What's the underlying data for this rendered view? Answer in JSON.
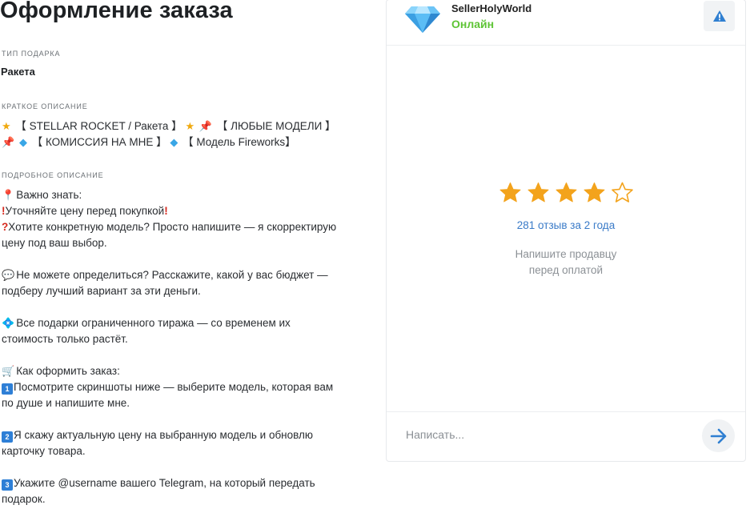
{
  "page": {
    "title": "Оформление заказа"
  },
  "gift_type": {
    "label": "ТИП ПОДАРКА",
    "value": "Ракета"
  },
  "short_description": {
    "label": "КРАТКОЕ ОПИСАНИЕ",
    "line1": "【 STELLAR ROCKET / Ракета 】",
    "line1b": "【 ЛЮБЫЕ МОДЕЛИ 】",
    "line2": "【 КОМИССИЯ НА МНЕ 】",
    "line2b": "【 Модель Fireworks】"
  },
  "long_description": {
    "label": "ПОДРОБНОЕ ОПИСАНИЕ",
    "important": "Важно знать:",
    "check_price": "Уточняйте цену перед покупкой",
    "want_model_1": "Хотите конкретную модель? Просто напишите — я скорректирую",
    "want_model_2": "цену под ваш выбор.",
    "budget_1": "Не можете определиться? Расскажите, какой у вас бюджет —",
    "budget_2": "подберу лучший вариант за эти деньги.",
    "limited_1": "Все подарки ограниченного тиража — со временем их",
    "limited_2": "стоимость только растёт.",
    "how_to": "Как оформить заказ:",
    "step1_num": "1",
    "step1_a": "Посмотрите скриншоты ниже — выберите модель, которая вам",
    "step1_b": "по душе и напишите мне.",
    "step2_num": "2",
    "step2_a": "Я скажу актуальную цену на выбранную модель и обновлю",
    "step2_b": "карточку товара.",
    "step3_num": "3",
    "step3_a": "Укажите @username вашего Telegram, на который передать",
    "step3_b": "подарок."
  },
  "seller": {
    "name": "SellerHolyWorld",
    "status": "Онлайн",
    "rating": 4,
    "rating_max": 5,
    "reviews": "281 отзыв за 2 года",
    "hint_line1": "Напишите продавцу",
    "hint_line2": "перед оплатой"
  },
  "chat": {
    "placeholder": "Написать..."
  },
  "icons": {
    "avatar": "diamond-gem-icon",
    "report": "warning-triangle-icon",
    "send": "arrow-right-icon",
    "star": "star-icon"
  },
  "colors": {
    "online": "#5ec435",
    "link": "#3a7bc8",
    "star": "#f3a31c",
    "accent": "#2e7fd6"
  }
}
